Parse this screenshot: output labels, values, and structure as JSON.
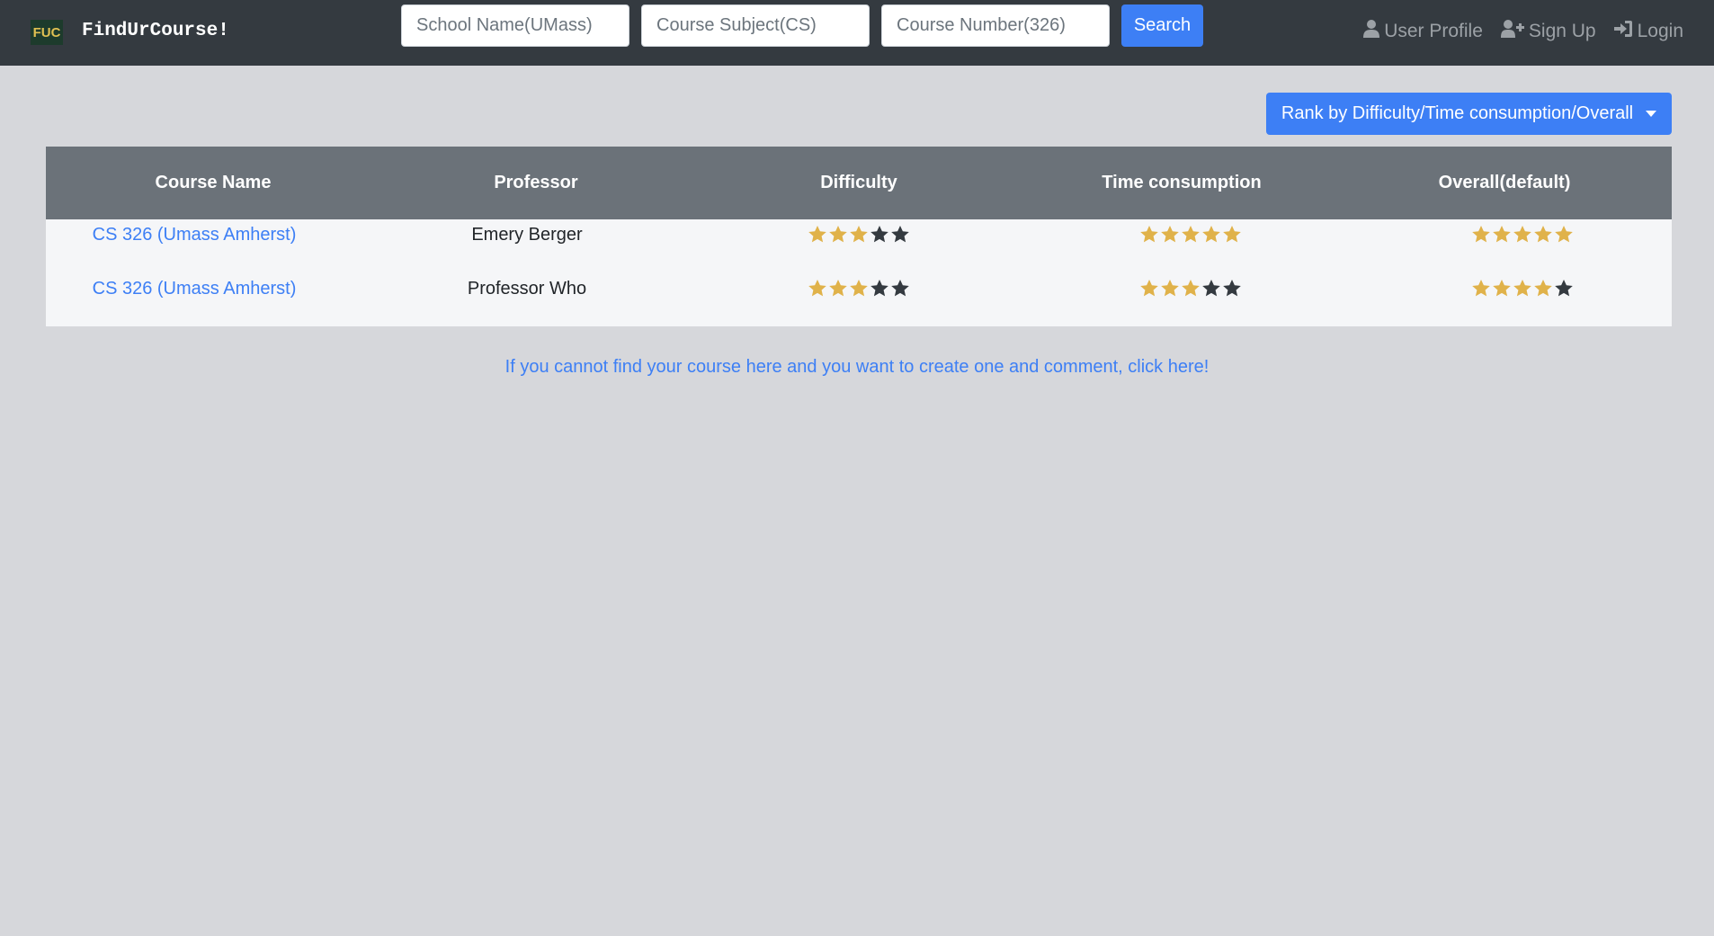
{
  "brand": {
    "logo_text": "FUC",
    "name": "FindUrCourse!"
  },
  "search": {
    "school_placeholder": "School Name(UMass)",
    "subject_placeholder": "Course Subject(CS)",
    "number_placeholder": "Course Number(326)",
    "button_label": "Search"
  },
  "nav": {
    "profile_label": "User Profile",
    "signup_label": "Sign Up",
    "login_label": "Login"
  },
  "rank_button_label": "Rank by Difficulty/Time consumption/Overall",
  "table": {
    "headers": [
      "Course Name",
      "Professor",
      "Difficulty",
      "Time consumption",
      "Overall(default)"
    ],
    "rows": [
      {
        "course": "CS 326 (Umass Amherst)",
        "professor": "Emery Berger",
        "difficulty": 3,
        "time": 5,
        "overall": 5
      },
      {
        "course": "CS 326 (Umass Amherst)",
        "professor": "Professor Who",
        "difficulty": 3,
        "time": 3,
        "overall": 4
      }
    ],
    "star_max": 5
  },
  "create_link_text": "If you cannot find your course here and you want to create one and comment, click here!",
  "colors": {
    "star_filled": "#e0b24a",
    "star_empty": "#343a40",
    "accent": "#3d7ff5",
    "navbar": "#343a40"
  }
}
